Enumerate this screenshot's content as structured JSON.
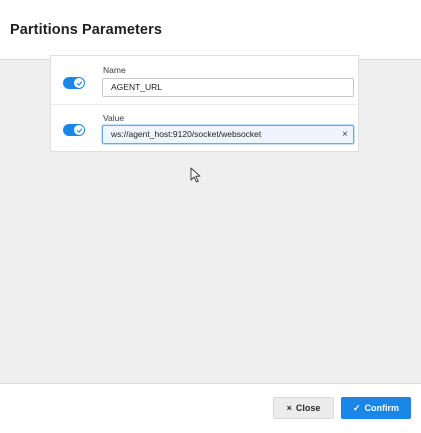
{
  "dialog": {
    "title": "Partitions Parameters"
  },
  "params": [
    {
      "enabled": true,
      "label": "Name",
      "value": "AGENT_URL"
    },
    {
      "enabled": true,
      "label": "Value",
      "value": "ws://agent_host:9120/socket/websocket",
      "clear_icon": "×"
    }
  ],
  "footer": {
    "close_label": "Close",
    "close_icon": "×",
    "confirm_label": "Confirm",
    "confirm_icon": "✓"
  },
  "colors": {
    "accent": "#1a86e8"
  }
}
